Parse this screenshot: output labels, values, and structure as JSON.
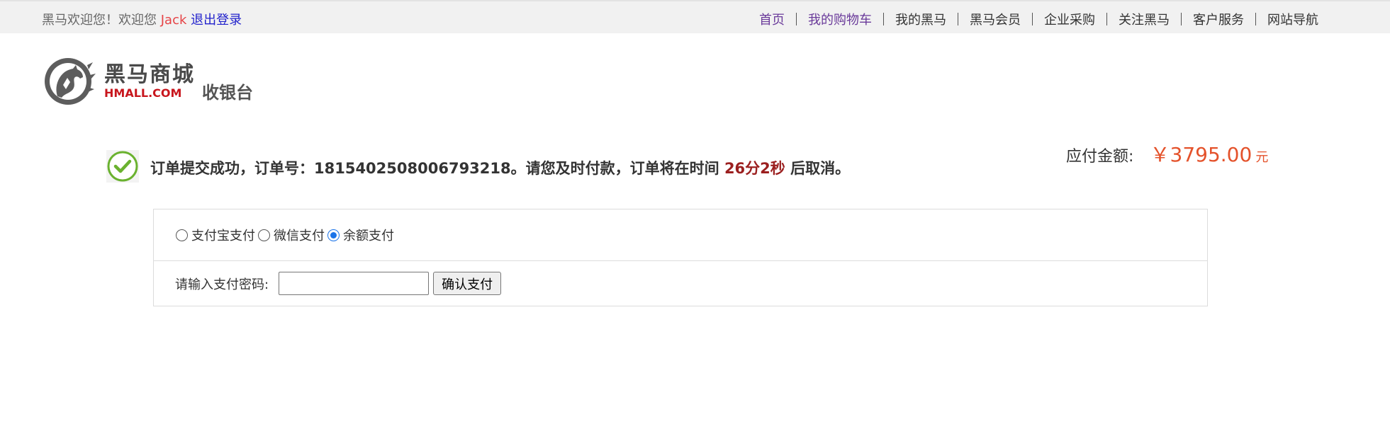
{
  "topbar": {
    "welcome_prefix": "黑马欢迎您！欢迎您",
    "username": "Jack",
    "logout": "退出登录",
    "nav": [
      "首页",
      "我的购物车",
      "我的黑马",
      "黑马会员",
      "企业采购",
      "关注黑马",
      "客户服务",
      "网站导航"
    ]
  },
  "logo": {
    "name_cn": "黑马商城",
    "name_en": "HMALL.COM",
    "subtitle": "收银台"
  },
  "order": {
    "message_prefix": "订单提交成功，订单号：1815402508006793218。请您及时付款，订单将在时间",
    "countdown": "26分2秒",
    "message_suffix": "后取消。",
    "amount_label": "应付金额:",
    "amount_value": "￥3795.00",
    "amount_unit": "元"
  },
  "payment": {
    "methods": [
      {
        "label": "支付宝支付",
        "checked": false
      },
      {
        "label": "微信支付",
        "checked": false
      },
      {
        "label": "余额支付",
        "checked": true
      }
    ],
    "password_label": "请输入支付密码:",
    "password_value": "",
    "confirm_label": "确认支付"
  },
  "colors": {
    "accent_red": "#e4522b",
    "countdown": "#9b1f1f",
    "success_green": "#6ab22f",
    "radio_blue": "#1a73e8"
  },
  "icons": [
    "horse-logo-icon",
    "success-check-icon"
  ]
}
